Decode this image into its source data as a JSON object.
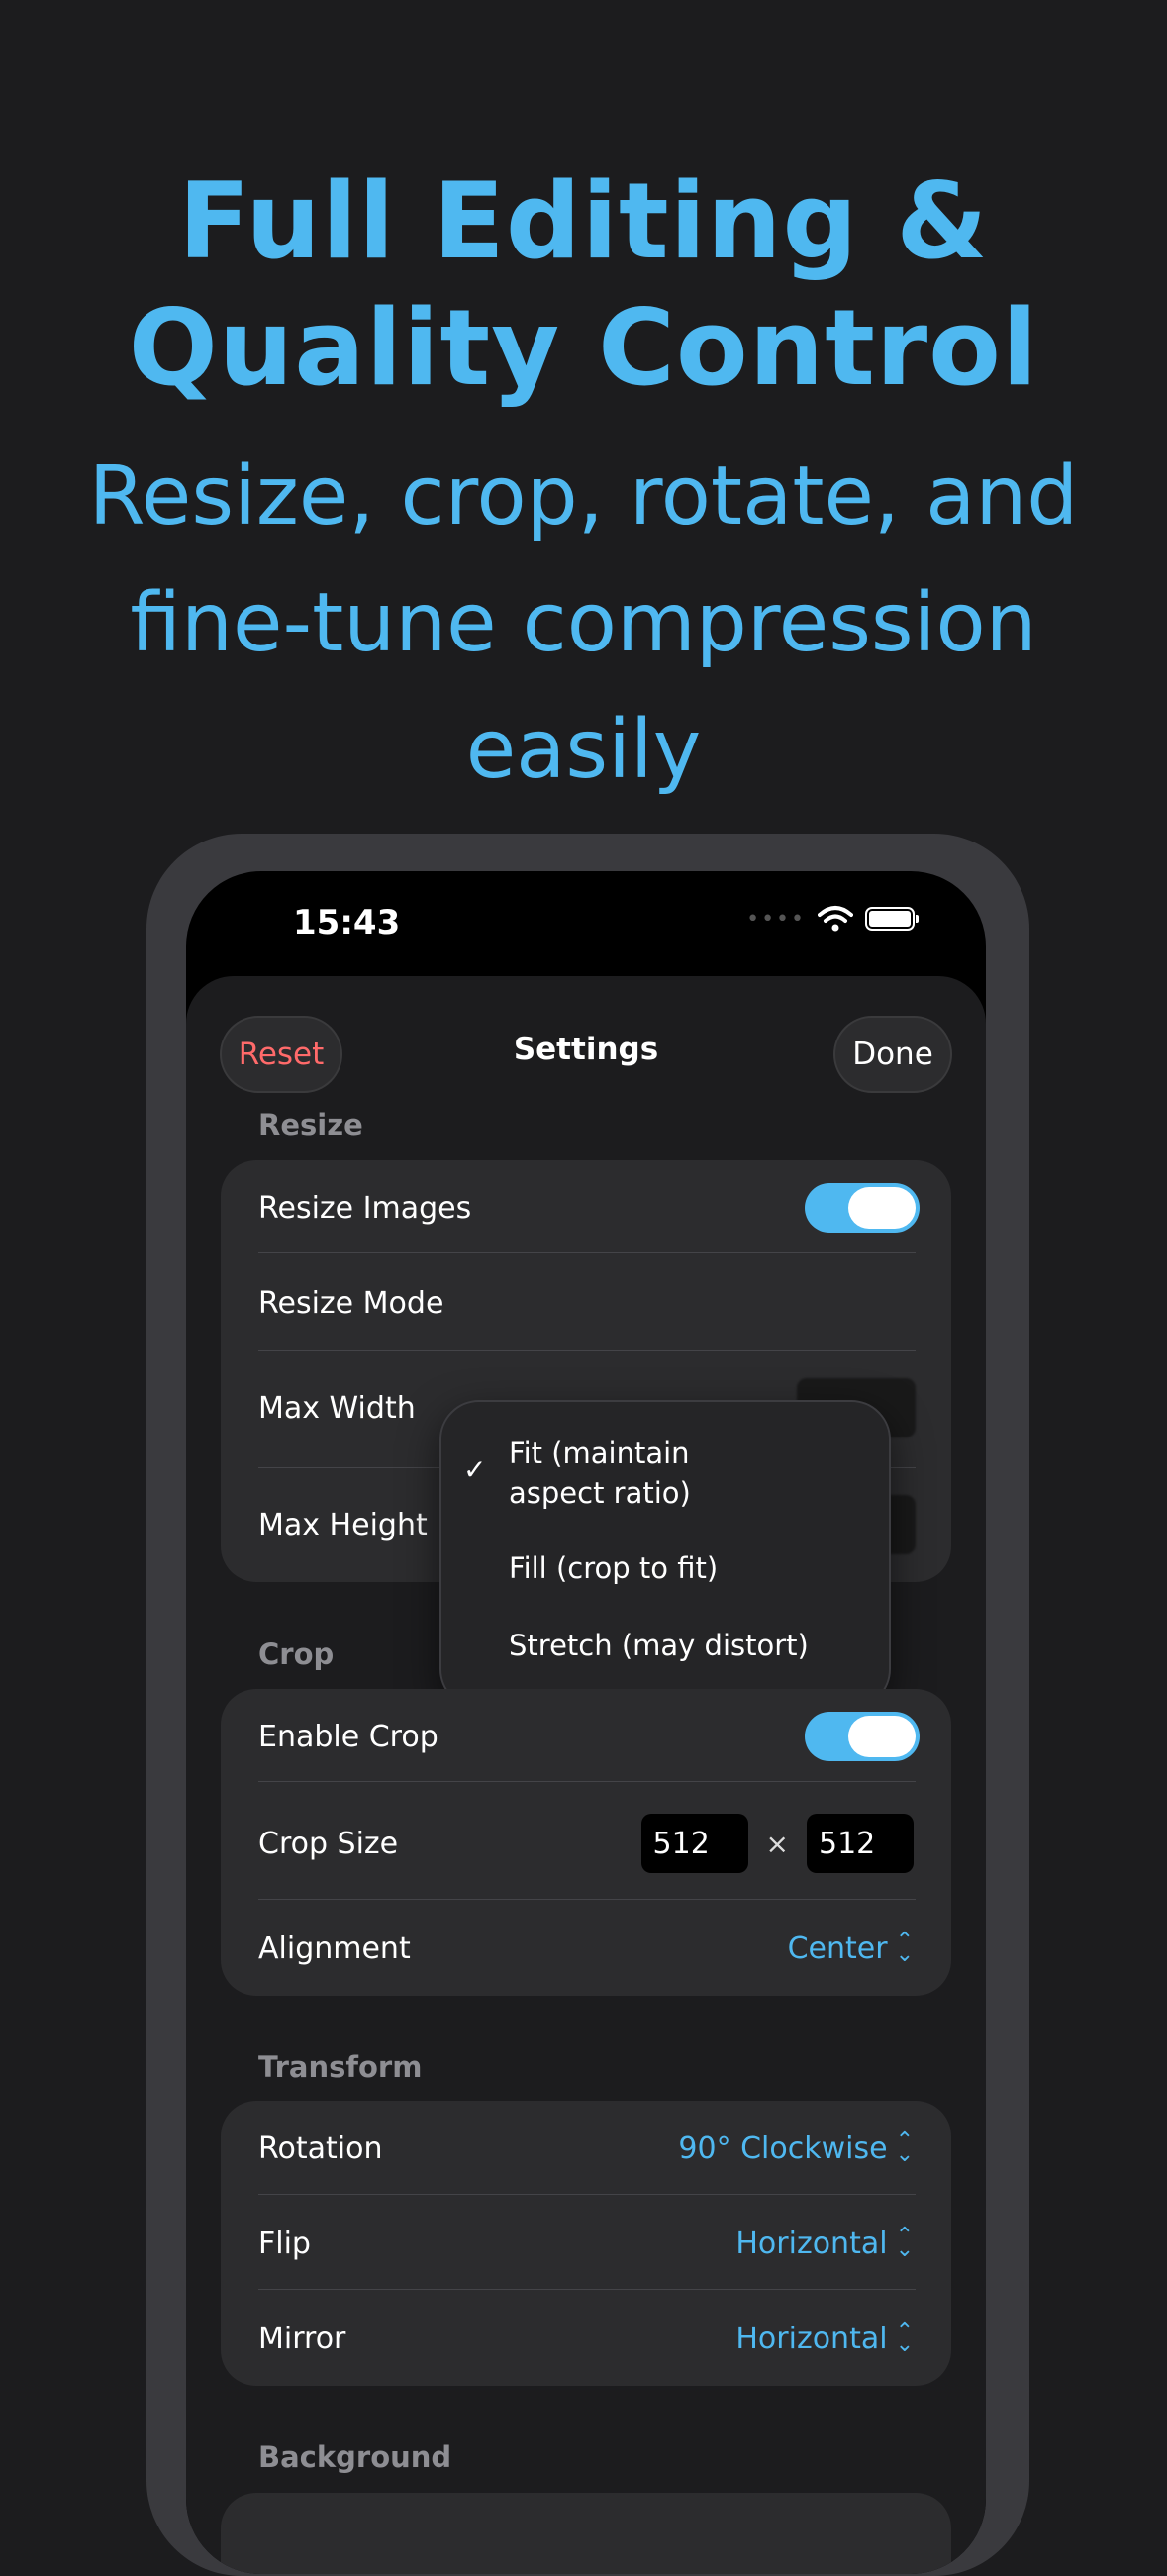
{
  "headline": {
    "line1": "Full Editing &",
    "line2": "Quality Control"
  },
  "subheadline": {
    "line1": "Resize, crop, rotate, and",
    "line2": "fine-tune compression easily"
  },
  "status": {
    "time": "15:43",
    "dots": "••••"
  },
  "nav": {
    "reset": "Reset",
    "title": "Settings",
    "done": "Done"
  },
  "resize": {
    "section": "Resize",
    "resize_images": "Resize Images",
    "resize_images_on": true,
    "resize_mode": "Resize Mode",
    "max_width": "Max Width",
    "max_height": "Max Height"
  },
  "menu": {
    "check": "✓",
    "fit_line1": "Fit (maintain",
    "fit_line2": "aspect ratio)",
    "fill": "Fill (crop to fit)",
    "stretch": "Stretch (may distort)"
  },
  "crop": {
    "section": "Crop",
    "enable_crop": "Enable Crop",
    "enable_crop_on": true,
    "crop_size": "Crop Size",
    "width": "512",
    "times": "×",
    "height": "512",
    "alignment": "Alignment",
    "alignment_value": "Center"
  },
  "transform": {
    "section": "Transform",
    "rotation": "Rotation",
    "rotation_value": "90° Clockwise",
    "flip": "Flip",
    "flip_value": "Horizontal",
    "mirror": "Mirror",
    "mirror_value": "Horizontal"
  },
  "background": {
    "section": "Background"
  },
  "colors": {
    "accent": "#4fb8f0",
    "destructive": "#ff6a6a",
    "background": "#1c1c1e"
  }
}
